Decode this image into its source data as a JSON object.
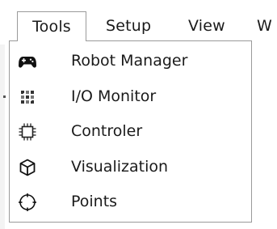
{
  "menubar": {
    "items": [
      {
        "label": "Tools"
      },
      {
        "label": "Setup"
      },
      {
        "label": "View"
      },
      {
        "label": "W"
      }
    ]
  },
  "tools_menu": {
    "items": [
      {
        "label": "Robot Manager",
        "icon": "gamepad-icon"
      },
      {
        "label": "I/O Monitor",
        "icon": "io-grid-icon"
      },
      {
        "label": "Controler",
        "icon": "chip-icon"
      },
      {
        "label": "Visualization",
        "icon": "cube-icon"
      },
      {
        "label": "Points",
        "icon": "crosshair-icon"
      }
    ]
  }
}
